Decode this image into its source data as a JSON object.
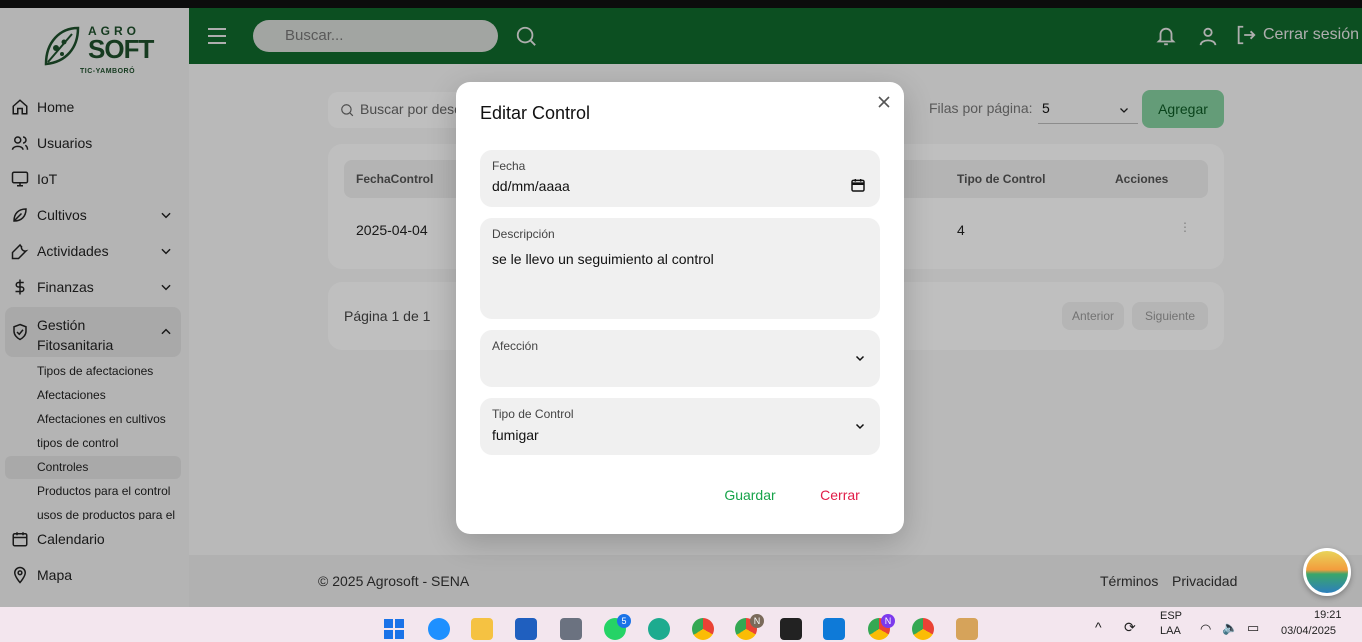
{
  "brand": {
    "name_top": "AGRO",
    "name_main": "SOFT",
    "tagline": "TIC-YAMBORÓ"
  },
  "header": {
    "search_placeholder": "Buscar...",
    "logout_label": "Cerrar sesión"
  },
  "sidebar": {
    "items": [
      {
        "label": "Home",
        "icon": "home-icon"
      },
      {
        "label": "Usuarios",
        "icon": "users-icon"
      },
      {
        "label": "IoT",
        "icon": "monitor-icon"
      },
      {
        "label": "Cultivos",
        "icon": "leaf-icon"
      },
      {
        "label": "Actividades",
        "icon": "wrench-icon"
      },
      {
        "label": "Finanzas",
        "icon": "dollar-icon"
      },
      {
        "label": "Gestión Fitosanitaria",
        "icon": "shield-icon"
      },
      {
        "label": "Calendario",
        "icon": "calendar-icon"
      },
      {
        "label": "Mapa",
        "icon": "map-pin-icon"
      }
    ],
    "sub_items": [
      "Tipos de afectaciones",
      "Afectaciones",
      "Afectaciones en cultivos",
      "tipos de control",
      "Controles",
      "Productos para el control",
      "usos de productos para el"
    ]
  },
  "toolbar": {
    "filter_placeholder": "Buscar por desc",
    "rows_label": "Filas por página:",
    "rows_value": "5",
    "add_label": "Agregar"
  },
  "table": {
    "headers": [
      "FechaControl",
      "Tipo de Control",
      "Acciones"
    ],
    "rows": [
      {
        "fecha": "2025-04-04",
        "tipo": "4"
      }
    ]
  },
  "pagination": {
    "text": "Página 1 de 1",
    "prev": "Anterior",
    "next": "Siguiente"
  },
  "footer": {
    "copyright": "© 2025 Agrosoft - SENA",
    "terms": "Términos",
    "privacy": "Privacidad"
  },
  "modal": {
    "title": "Editar Control",
    "fecha_label": "Fecha",
    "fecha_value": "dd/mm/aaaa",
    "descripcion_label": "Descripción",
    "descripcion_value": "se le llevo un seguimiento al control",
    "afeccion_label": "Afección",
    "afeccion_value": "",
    "tipo_label": "Tipo de Control",
    "tipo_value": "fumigar",
    "save_label": "Guardar",
    "cancel_label": "Cerrar"
  },
  "taskbar": {
    "whatsapp_badge": "5",
    "chrome_badge_1": "N",
    "chrome_badge_2": "N",
    "lang_top": "ESP",
    "lang_bottom": "LAA",
    "time": "19:21",
    "date": "03/04/2025"
  }
}
